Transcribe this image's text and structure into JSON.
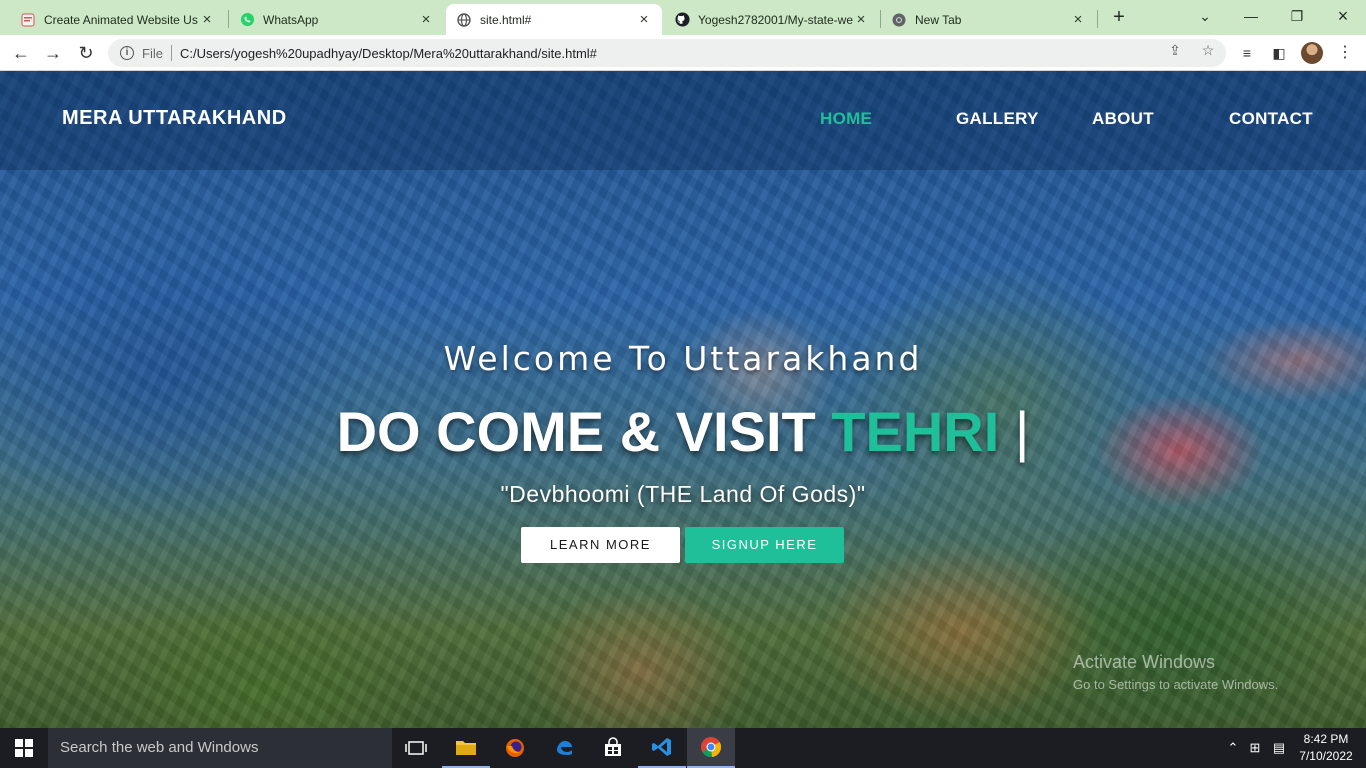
{
  "browser": {
    "tabs": [
      {
        "title": "Create Animated Website Us",
        "icon": "document-icon"
      },
      {
        "title": "WhatsApp",
        "icon": "whatsapp-icon"
      },
      {
        "title": "site.html#",
        "icon": "globe-icon",
        "active": true
      },
      {
        "title": "Yogesh2782001/My-state-we",
        "icon": "github-icon"
      },
      {
        "title": "New Tab",
        "icon": "chrome-icon"
      }
    ],
    "new_tab": "+",
    "scheme_label": "File",
    "url": "C:/Users/yogesh%20upadhyay/Desktop/Mera%20uttarakhand/site.html#"
  },
  "site": {
    "brand": "MERA UTTARAKHAND",
    "nav": [
      "HOME",
      "GALLERY",
      "ABOUT",
      "CONTACT"
    ],
    "active_nav": "HOME",
    "welcome": "Welcome To Uttarakhand",
    "headline_prefix": "DO COME & VISIT",
    "headline_accent": "TEHRI",
    "headline_cursor": "|",
    "tagline": "\"Devbhoomi (THE Land Of Gods)\"",
    "buttons": {
      "learn_more": "LEARN MORE",
      "signup": "SIGNUP HERE"
    },
    "colors": {
      "accent": "#1fbf9a",
      "brand": "#ffffff"
    }
  },
  "watermark": {
    "title": "Activate Windows",
    "subtitle": "Go to Settings to activate Windows."
  },
  "taskbar": {
    "search_placeholder": "Search the web and Windows",
    "apps": [
      "task-view-icon",
      "file-explorer-icon",
      "firefox-icon",
      "edge-icon",
      "store-icon",
      "vscode-icon",
      "chrome-icon"
    ],
    "time": "8:42 PM",
    "date": "7/10/2022"
  }
}
